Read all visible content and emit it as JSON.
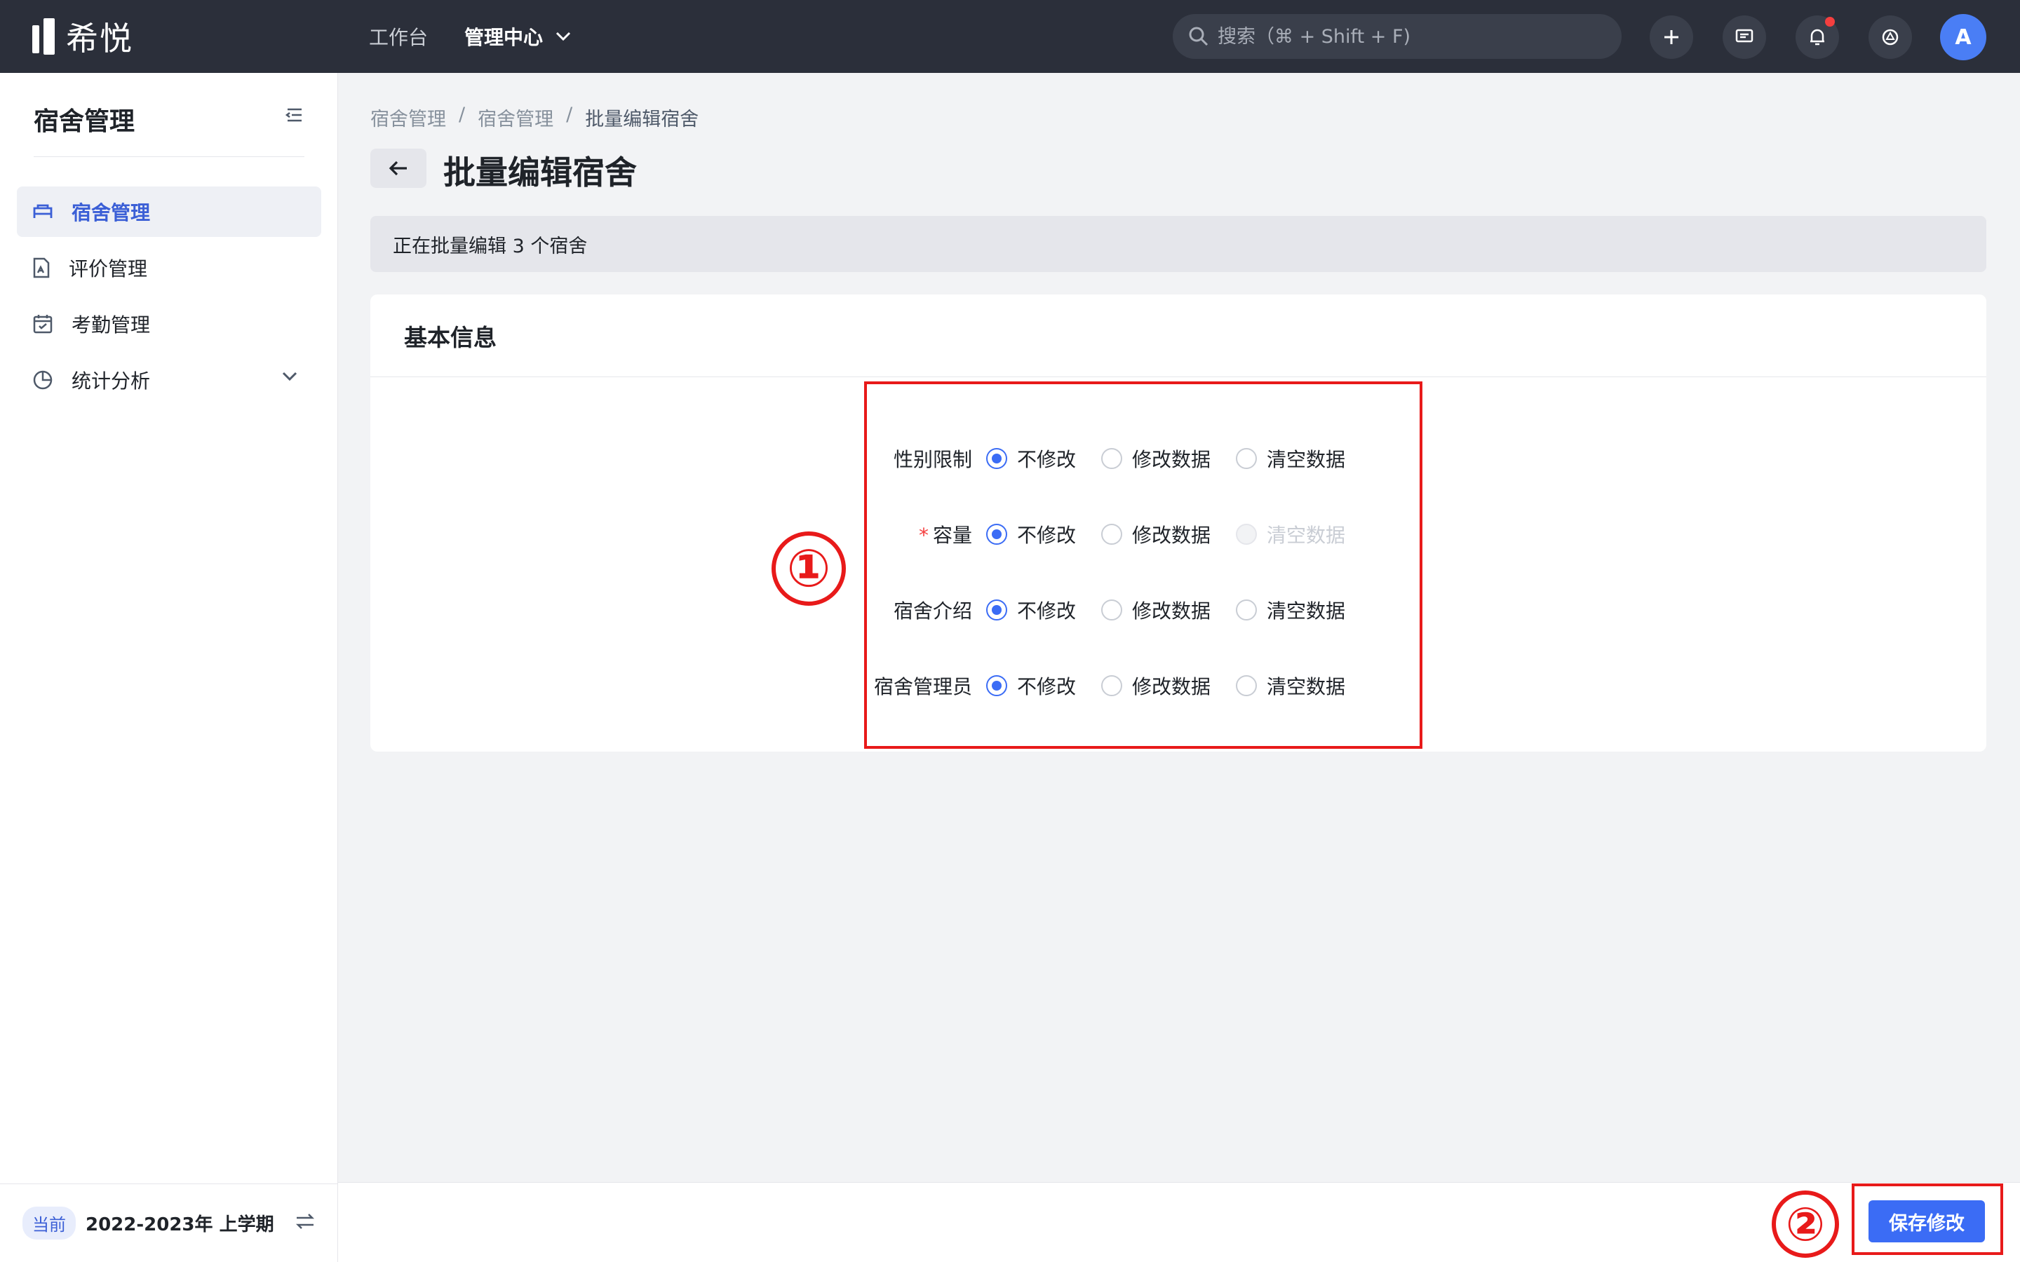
{
  "topbar": {
    "logo_text": "希悦",
    "nav": [
      {
        "label": "工作台",
        "active": false
      },
      {
        "label": "管理中心",
        "active": true
      }
    ],
    "search_placeholder": "搜索（⌘ + Shift + F)",
    "avatar_letter": "A"
  },
  "sidebar": {
    "title": "宿舍管理",
    "items": [
      {
        "label": "宿舍管理",
        "icon": "bed-icon",
        "active": true
      },
      {
        "label": "评价管理",
        "icon": "document-icon",
        "active": false
      },
      {
        "label": "考勤管理",
        "icon": "calendar-icon",
        "active": false
      },
      {
        "label": "统计分析",
        "icon": "pie-chart-icon",
        "active": false
      }
    ],
    "footer_badge": "当前",
    "footer_term": "2022-2023年 上学期"
  },
  "main": {
    "breadcrumb": [
      "宿舍管理",
      "宿舍管理",
      "批量编辑宿舍"
    ],
    "breadcrumb_sep": "/",
    "title": "批量编辑宿舍",
    "notice": "正在批量编辑 3 个宿舍",
    "card_title": "基本信息",
    "fields": [
      {
        "label": "性别限制",
        "required": false
      },
      {
        "label": "容量",
        "required": true
      },
      {
        "label": "宿舍介绍",
        "required": false
      },
      {
        "label": "宿舍管理员",
        "required": false
      }
    ],
    "options": [
      "不修改",
      "修改数据",
      "清空数据"
    ],
    "required_mark": "*"
  },
  "annotations": {
    "one": "①",
    "two": "②"
  },
  "footer": {
    "save_label": "保存修改"
  },
  "colors": {
    "primary": "#3b6cf5",
    "annotation": "#e81a1a",
    "topbar": "#2b2f3a"
  }
}
